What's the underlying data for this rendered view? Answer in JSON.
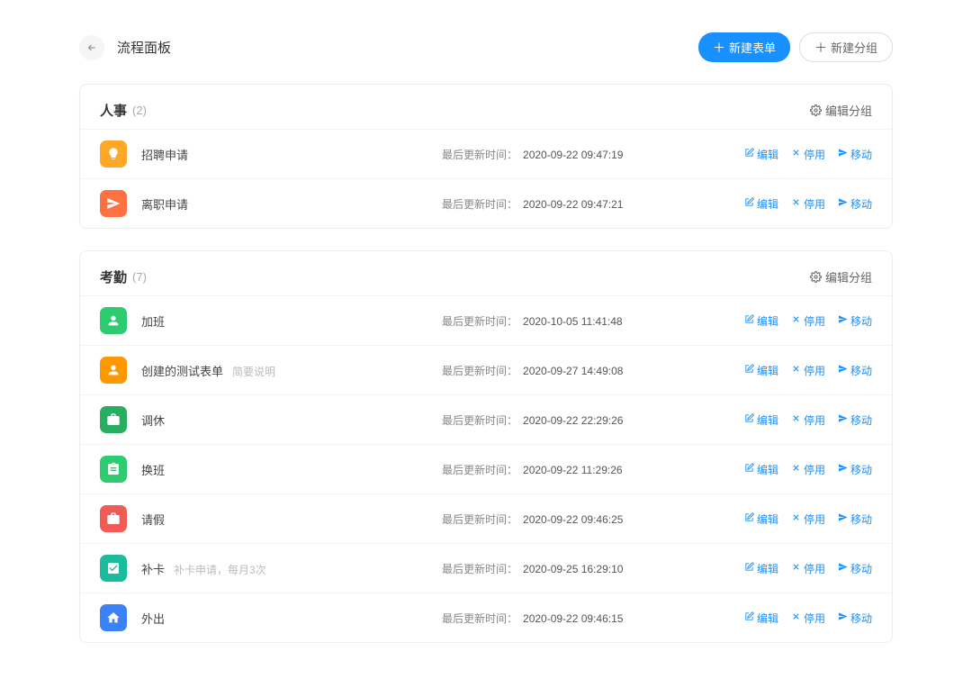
{
  "header": {
    "title": "流程面板",
    "new_form": "新建表单",
    "new_group": "新建分组"
  },
  "labels": {
    "edit_group": "编辑分组",
    "last_updated": "最后更新时间：",
    "edit": "编辑",
    "disable": "停用",
    "move": "移动"
  },
  "groups": [
    {
      "name": "人事",
      "count": "(2)",
      "items": [
        {
          "title": "招聘申请",
          "desc": "",
          "time": "2020-09-22 09:47:19",
          "icon": "bulb",
          "color": "bg-orange"
        },
        {
          "title": "离职申请",
          "desc": "",
          "time": "2020-09-22 09:47:21",
          "icon": "send",
          "color": "bg-deeporange"
        }
      ]
    },
    {
      "name": "考勤",
      "count": "(7)",
      "items": [
        {
          "title": "加班",
          "desc": "",
          "time": "2020-10-05 11:41:48",
          "icon": "person",
          "color": "bg-green"
        },
        {
          "title": "创建的测试表单",
          "desc": "简要说明",
          "time": "2020-09-27 14:49:08",
          "icon": "person",
          "color": "bg-orange2"
        },
        {
          "title": "调休",
          "desc": "",
          "time": "2020-09-22 22:29:26",
          "icon": "briefcase",
          "color": "bg-green2"
        },
        {
          "title": "换班",
          "desc": "",
          "time": "2020-09-22 11:29:26",
          "icon": "clipboard",
          "color": "bg-green3"
        },
        {
          "title": "请假",
          "desc": "",
          "time": "2020-09-22 09:46:25",
          "icon": "briefcase",
          "color": "bg-red"
        },
        {
          "title": "补卡",
          "desc": "补卡申请，每月3次",
          "time": "2020-09-25 16:29:10",
          "icon": "check",
          "color": "bg-teal"
        },
        {
          "title": "外出",
          "desc": "",
          "time": "2020-09-22 09:46:15",
          "icon": "home",
          "color": "bg-blue"
        }
      ]
    }
  ]
}
